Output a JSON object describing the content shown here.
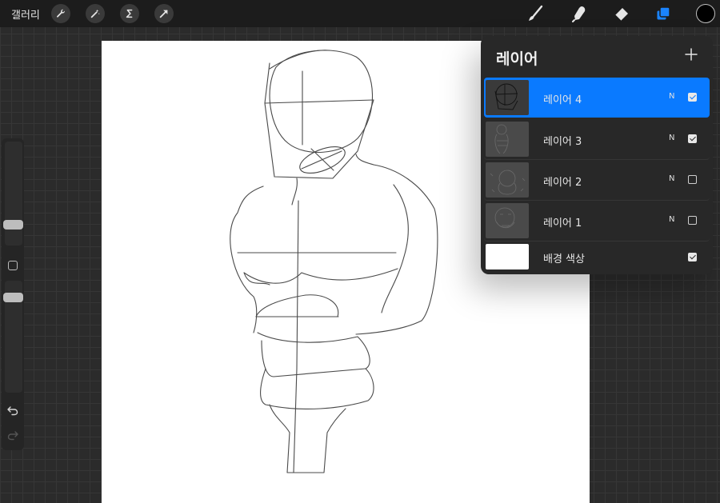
{
  "topbar": {
    "gallery_label": "갤러리",
    "left_tools": [
      "wrench-icon",
      "magic-wand-icon",
      "selection-icon",
      "transform-arrow-icon"
    ],
    "right_tools": [
      "brush-icon",
      "smudge-icon",
      "eraser-icon",
      "layers-icon"
    ],
    "active_tool_color": "#1a84ff",
    "current_color": "#000000"
  },
  "sidebar": {
    "brush_size_level": 0.27,
    "opacity_level": 0.2
  },
  "layers": {
    "title": "레이어",
    "items": [
      {
        "name": "레이어 4",
        "blend": "N",
        "visible": true,
        "active": true
      },
      {
        "name": "레이어 3",
        "blend": "N",
        "visible": true,
        "active": false
      },
      {
        "name": "레이어 2",
        "blend": "N",
        "visible": false,
        "active": false
      },
      {
        "name": "레이어 1",
        "blend": "N",
        "visible": false,
        "active": false
      }
    ],
    "background": {
      "name": "배경 색상",
      "visible": true,
      "color": "#ffffff"
    },
    "active_color": "#0a7aff"
  }
}
